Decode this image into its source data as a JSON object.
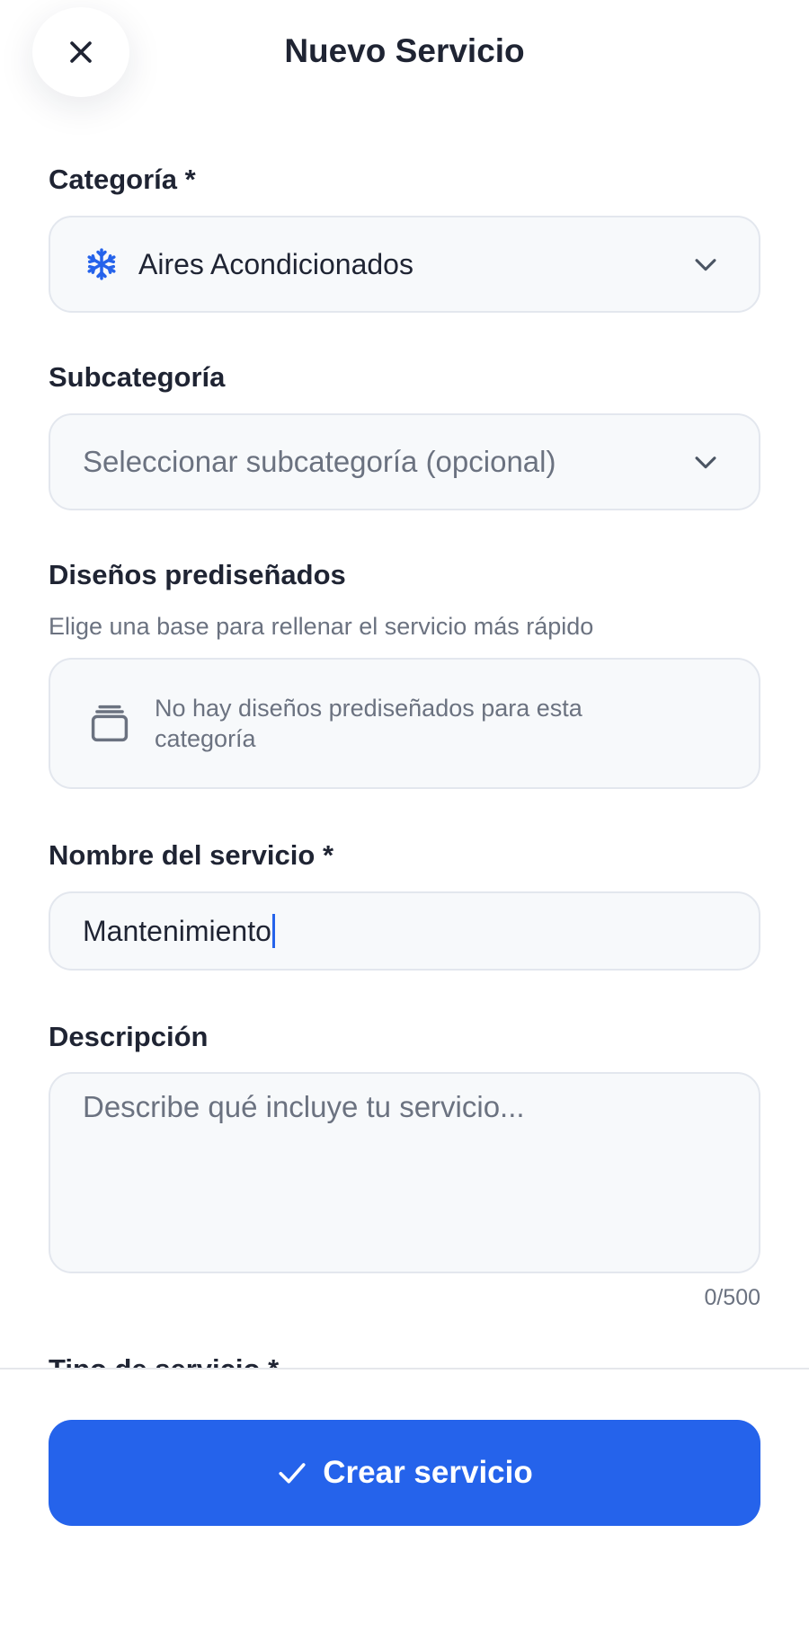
{
  "header": {
    "title": "Nuevo Servicio",
    "close_icon": "close-icon"
  },
  "form": {
    "category": {
      "label": "Categoría *",
      "value": "Aires Acondicionados",
      "icon": "snowflake-icon",
      "icon_color": "#2563eb"
    },
    "subcategory": {
      "label": "Subcategoría",
      "placeholder": "Seleccionar subcategoría (opcional)"
    },
    "templates": {
      "label": "Diseños prediseñados",
      "hint": "Elige una base para rellenar el servicio más rápido",
      "empty_text": "No hay diseños prediseñados para esta categoría",
      "icon": "stack-icon"
    },
    "service_name": {
      "label": "Nombre del servicio *",
      "value": "Mantenimiento"
    },
    "description": {
      "label": "Descripción",
      "placeholder": "Describe qué incluye tu servicio...",
      "counter": "0/500"
    },
    "next_section": {
      "label": "Tipo de servicio *"
    }
  },
  "footer": {
    "submit_label": "Crear servicio",
    "submit_icon": "check-icon"
  },
  "colors": {
    "accent": "#2563eb",
    "field_bg": "#f7f9fb",
    "field_border": "#e3e7ee",
    "text": "#1f2433",
    "muted": "#6b7280"
  }
}
